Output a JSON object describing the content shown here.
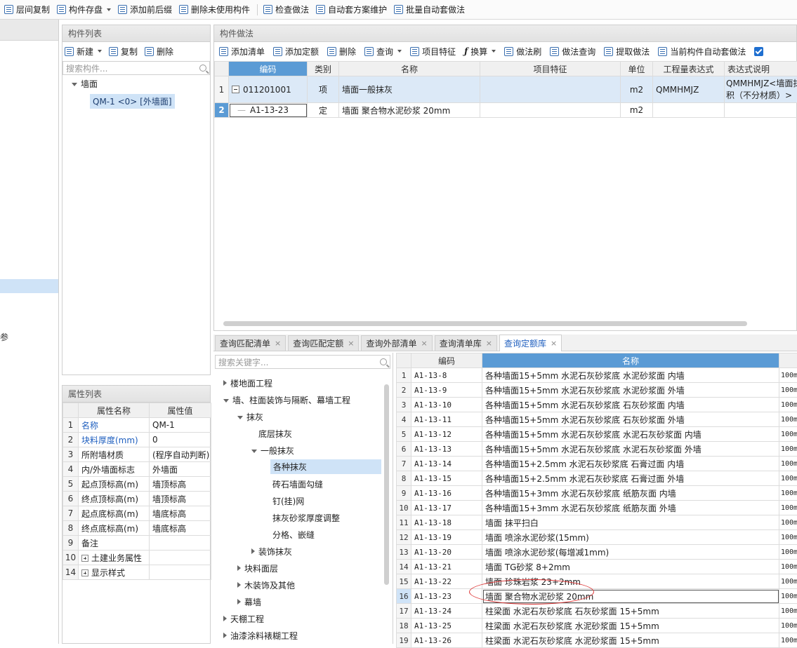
{
  "top_toolbar": {
    "items": [
      "层间复制",
      "构件存盘",
      "添加前后缀",
      "删除未使用构件",
      "检查做法",
      "自动套方案维护",
      "批量自动套做法"
    ]
  },
  "left_strip": {
    "fragment": "参"
  },
  "component_panel": {
    "title": "构件列表",
    "toolbar": {
      "new": "新建",
      "copy": "复制",
      "delete": "删除"
    },
    "search_placeholder": "搜索构件...",
    "tree": {
      "group": "墙面",
      "item": "QM-1 <0> [外墙面]"
    }
  },
  "property_panel": {
    "title": "属性列表",
    "headers": [
      "属性名称",
      "属性值"
    ],
    "rows": [
      {
        "num": "1",
        "name": "名称",
        "value": "QM-1"
      },
      {
        "num": "2",
        "name": "块料厚度(mm)",
        "value": "0"
      },
      {
        "num": "3",
        "name": "所附墙材质",
        "value": "(程序自动判断)"
      },
      {
        "num": "4",
        "name": "内/外墙面标志",
        "value": "外墙面"
      },
      {
        "num": "5",
        "name": "起点顶标高(m)",
        "value": "墙顶标高"
      },
      {
        "num": "6",
        "name": "终点顶标高(m)",
        "value": "墙顶标高"
      },
      {
        "num": "7",
        "name": "起点底标高(m)",
        "value": "墙底标高"
      },
      {
        "num": "8",
        "name": "终点底标高(m)",
        "value": "墙底标高"
      },
      {
        "num": "9",
        "name": "备注",
        "value": ""
      },
      {
        "num": "10",
        "name": "土建业务属性",
        "value": ""
      },
      {
        "num": "14",
        "name": "显示样式",
        "value": ""
      }
    ]
  },
  "method_panel": {
    "title": "构件做法",
    "toolbar": [
      "添加清单",
      "添加定额",
      "删除",
      "查询",
      "项目特征",
      "换算",
      "做法刷",
      "做法查询",
      "提取做法",
      "当前构件自动套做法"
    ],
    "headers": [
      "编码",
      "类别",
      "名称",
      "项目特征",
      "单位",
      "工程量表达式",
      "表达式说明"
    ],
    "rows": [
      {
        "num": "1",
        "code": "011201001",
        "type": "项",
        "name": "墙面一般抹灰",
        "feature": "",
        "unit": "m2",
        "expr": "QMMHMJZ",
        "desc1": "QMMHMJZ<墙面抹",
        "desc2": "积（不分材质）>"
      },
      {
        "num": "2",
        "code": "A1-13-23",
        "type": "定",
        "name": "墙面 聚合物水泥砂浆 20mm",
        "feature": "",
        "unit": "m2",
        "expr": "",
        "desc1": "",
        "desc2": ""
      }
    ]
  },
  "tabs": [
    {
      "label": "查询匹配清单",
      "active": false
    },
    {
      "label": "查询匹配定额",
      "active": false
    },
    {
      "label": "查询外部清单",
      "active": false
    },
    {
      "label": "查询清单库",
      "active": false
    },
    {
      "label": "查询定额库",
      "active": true
    }
  ],
  "quota_tree": {
    "search_placeholder": "搜索关键字...",
    "items": [
      {
        "label": "楼地面工程"
      },
      {
        "label": "墙、柱面装饰与隔断、幕墙工程"
      },
      {
        "label": "抹灰"
      },
      {
        "label": "底层抹灰"
      },
      {
        "label": "一般抹灰"
      },
      {
        "label": "各种抹灰"
      },
      {
        "label": "砖石墙面勾缝"
      },
      {
        "label": "钉(挂)网"
      },
      {
        "label": "抹灰砂浆厚度调整"
      },
      {
        "label": "分格、嵌缝"
      },
      {
        "label": "装饰抹灰"
      },
      {
        "label": "块料面层"
      },
      {
        "label": "木装饰及其他"
      },
      {
        "label": "幕墙"
      },
      {
        "label": "天棚工程"
      },
      {
        "label": "油漆涂料裱糊工程"
      }
    ]
  },
  "quota_table": {
    "headers": [
      "编码",
      "名称"
    ],
    "unit_fragment": "100m",
    "rows": [
      {
        "num": "1",
        "code": "A1-13-8",
        "name": "各种墙面15+5mm 水泥石灰砂浆底 水泥砂浆面 内墙"
      },
      {
        "num": "2",
        "code": "A1-13-9",
        "name": "各种墙面15+5mm 水泥石灰砂浆底 水泥砂浆面 外墙"
      },
      {
        "num": "3",
        "code": "A1-13-10",
        "name": "各种墙面15+5mm 水泥石灰砂浆底 石灰砂浆面 内墙"
      },
      {
        "num": "4",
        "code": "A1-13-11",
        "name": "各种墙面15+5mm 水泥石灰砂浆底 石灰砂浆面 外墙"
      },
      {
        "num": "5",
        "code": "A1-13-12",
        "name": "各种墙面15+5mm 水泥石灰砂浆底 水泥石灰砂浆面 内墙"
      },
      {
        "num": "6",
        "code": "A1-13-13",
        "name": "各种墙面15+5mm 水泥石灰砂浆底 水泥石灰砂浆面 外墙"
      },
      {
        "num": "7",
        "code": "A1-13-14",
        "name": "各种墙面15+2.5mm 水泥石灰砂浆底 石膏过面 内墙"
      },
      {
        "num": "8",
        "code": "A1-13-15",
        "name": "各种墙面15+2.5mm 水泥石灰砂浆底 石膏过面 外墙"
      },
      {
        "num": "9",
        "code": "A1-13-16",
        "name": "各种墙面15+3mm 水泥石灰砂浆底 纸筋灰面 内墙"
      },
      {
        "num": "10",
        "code": "A1-13-17",
        "name": "各种墙面15+3mm 水泥石灰砂浆底 纸筋灰面 外墙"
      },
      {
        "num": "11",
        "code": "A1-13-18",
        "name": "墙面 抹平扫白"
      },
      {
        "num": "12",
        "code": "A1-13-19",
        "name": "墙面 喷涂水泥砂浆(15mm)"
      },
      {
        "num": "13",
        "code": "A1-13-20",
        "name": "墙面 喷涂水泥砂浆(每增减1mm)"
      },
      {
        "num": "14",
        "code": "A1-13-21",
        "name": "墙面 TG砂浆 8+2mm"
      },
      {
        "num": "15",
        "code": "A1-13-22",
        "name": "墙面 珍珠岩浆 23+2mm"
      },
      {
        "num": "16",
        "code": "A1-13-23",
        "name": "墙面 聚合物水泥砂浆 20mm"
      },
      {
        "num": "17",
        "code": "A1-13-24",
        "name": "柱梁面 水泥石灰砂浆底 石灰砂浆面 15+5mm"
      },
      {
        "num": "18",
        "code": "A1-13-25",
        "name": "柱梁面 水泥石灰砂浆底 水泥砂浆面 15+5mm"
      },
      {
        "num": "19",
        "code": "A1-13-26",
        "name": "柱梁面 水泥石灰砂浆底 水泥砂浆面 15+5mm"
      }
    ]
  },
  "colors": {
    "accent": "#5b9bd5",
    "selection": "#cfe3f7",
    "link": "#1f5fbf",
    "annotation": "#dd3333"
  }
}
